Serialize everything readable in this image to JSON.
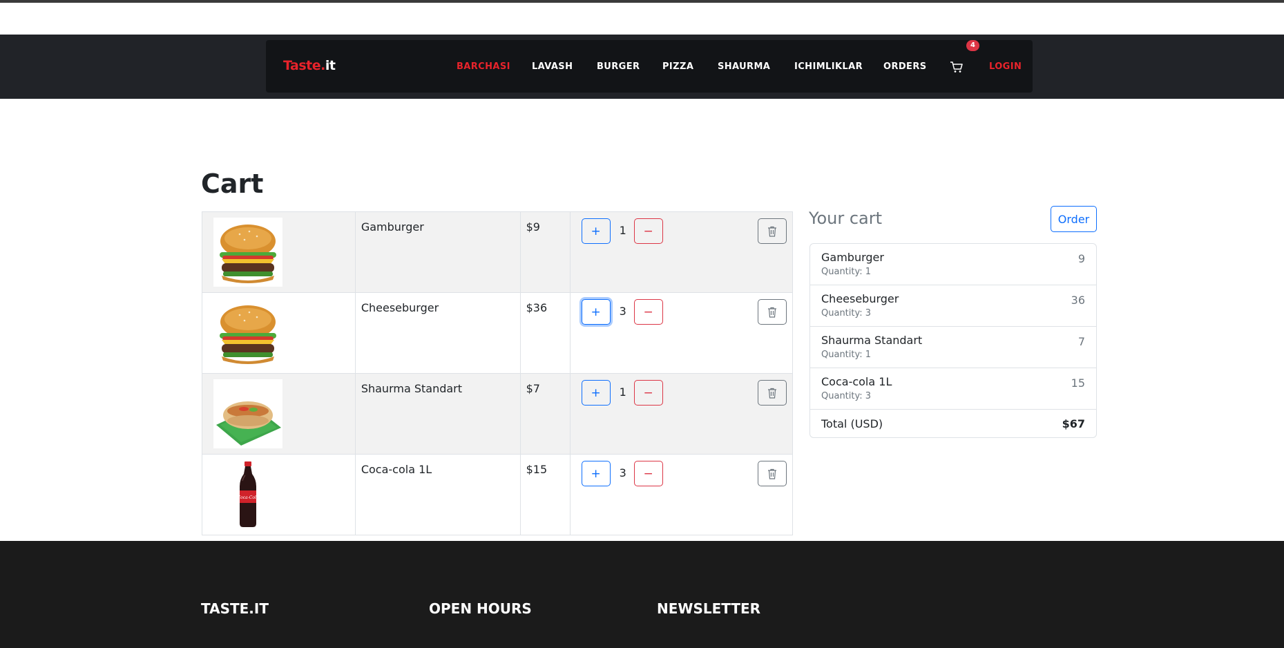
{
  "brand": {
    "part1": "Taste.",
    "part2": "it"
  },
  "nav": {
    "items": [
      "BARCHASI",
      "LAVASH",
      "BURGER",
      "PIZZA",
      "SHAURMA",
      "ICHIMLIKLAR",
      "ORDERS"
    ],
    "active": "BARCHASI",
    "cart_count": "4",
    "login": "LOGIN"
  },
  "page": {
    "title": "Cart"
  },
  "cart": {
    "rows": [
      {
        "name": "Gamburger",
        "price": "$9",
        "qty": "1",
        "image": "burger"
      },
      {
        "name": "Cheeseburger",
        "price": "$36",
        "qty": "3",
        "image": "burger"
      },
      {
        "name": "Shaurma Standart",
        "price": "$7",
        "qty": "1",
        "image": "shaurma"
      },
      {
        "name": "Coca-cola 1L",
        "price": "$15",
        "qty": "3",
        "image": "cola"
      }
    ],
    "plus_label": "+",
    "minus_label": "−"
  },
  "summary": {
    "title": "Your cart",
    "order_button": "Order",
    "items": [
      {
        "name": "Gamburger",
        "qty_label": "Quantity: 1",
        "value": "9"
      },
      {
        "name": "Cheeseburger",
        "qty_label": "Quantity: 3",
        "value": "36"
      },
      {
        "name": "Shaurma Standart",
        "qty_label": "Quantity: 1",
        "value": "7"
      },
      {
        "name": "Coca-cola 1L",
        "qty_label": "Quantity: 3",
        "value": "15"
      }
    ],
    "total_label": "Total (USD)",
    "total_value": "$67"
  },
  "footer": {
    "col1": "TASTE.IT",
    "col2": "OPEN HOURS",
    "col3": "NEWSLETTER"
  },
  "colors": {
    "accent": "#e8232b",
    "primary": "#0d6efd",
    "danger": "#dc3545",
    "nav_bg": "#212328",
    "footer_bg": "#1b1b1b"
  }
}
